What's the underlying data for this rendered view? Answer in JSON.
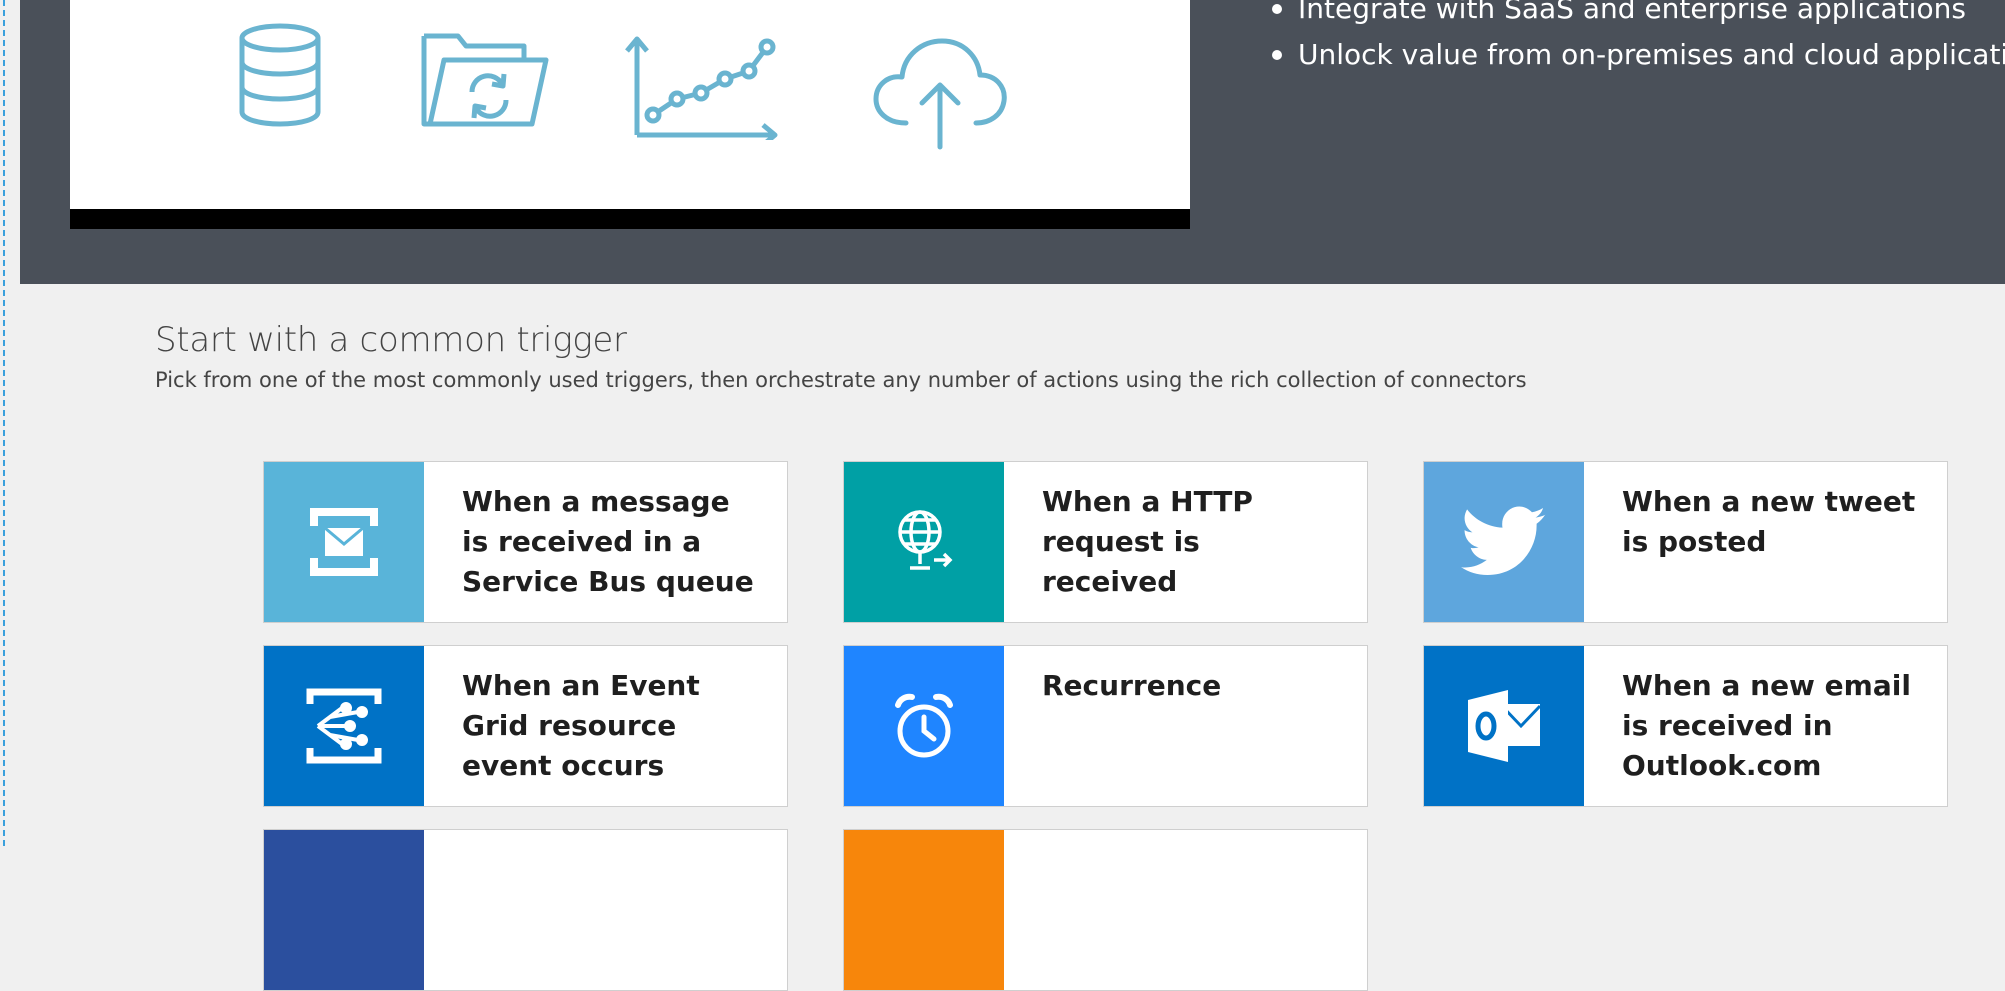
{
  "hero": {
    "video_icons": [
      "database-icon",
      "folder-sync-icon",
      "line-chart-icon",
      "cloud-upload-icon"
    ],
    "bullets": [
      "Integrate with SaaS and enterprise applications",
      "Unlock value from on-premises and cloud applications"
    ]
  },
  "section": {
    "title": "Start with a common trigger",
    "subtitle": "Pick from one of the most commonly used triggers, then orchestrate any number of actions using the rich collection of connectors"
  },
  "triggers": [
    {
      "label": "When a message is received in a Service Bus queue",
      "icon": "service-bus-icon",
      "color": "#59b4d9"
    },
    {
      "label": "When a HTTP request is received",
      "icon": "http-globe-icon",
      "color": "#00a0a5"
    },
    {
      "label": "When a new tweet is posted",
      "icon": "twitter-icon",
      "color": "#5ea6dd"
    },
    {
      "label": "When an Event Grid resource event occurs",
      "icon": "event-grid-icon",
      "color": "#0072c6"
    },
    {
      "label": "Recurrence",
      "icon": "alarm-clock-icon",
      "color": "#1f85ff"
    },
    {
      "label": "When a new email is received in Outlook.com",
      "icon": "outlook-icon",
      "color": "#0072c6"
    },
    {
      "label": "",
      "icon": "",
      "color": "#2b4f9e"
    },
    {
      "label": "",
      "icon": "",
      "color": "#f7860b"
    }
  ],
  "colors": {
    "hero_bg": "#4a5059",
    "page_bg": "#f0f0f0",
    "icon_stroke": "#6ab4d0"
  }
}
